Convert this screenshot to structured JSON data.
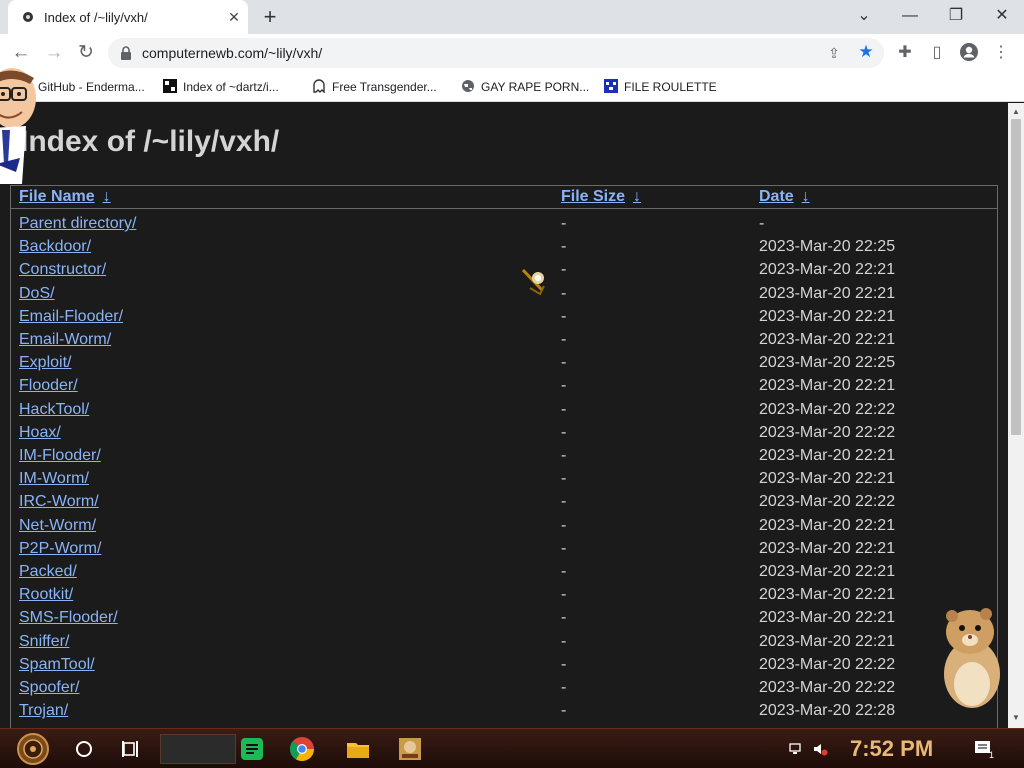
{
  "tab": {
    "title": "Index of /~lily/vxh/"
  },
  "omnibox": {
    "url": "computernewb.com/~lily/vxh/"
  },
  "bookmarks": [
    {
      "label": "GitHub - Enderma..."
    },
    {
      "label": "Index of ~dartz/i..."
    },
    {
      "label": "Free Transgender..."
    },
    {
      "label": "GAY RAPE PORN..."
    },
    {
      "label": "FILE ROULETTE"
    }
  ],
  "page": {
    "heading": "Index of /~lily/vxh/",
    "columns": {
      "name": "File Name",
      "size": "File Size",
      "date": "Date",
      "sort_arrow": "↓"
    },
    "rows": [
      {
        "name": "Parent directory/",
        "size": "-",
        "date": "-"
      },
      {
        "name": "Backdoor/",
        "size": "-",
        "date": "2023-Mar-20 22:25"
      },
      {
        "name": "Constructor/",
        "size": "-",
        "date": "2023-Mar-20 22:21"
      },
      {
        "name": "DoS/",
        "size": "-",
        "date": "2023-Mar-20 22:21"
      },
      {
        "name": "Email-Flooder/",
        "size": "-",
        "date": "2023-Mar-20 22:21"
      },
      {
        "name": "Email-Worm/",
        "size": "-",
        "date": "2023-Mar-20 22:21"
      },
      {
        "name": "Exploit/",
        "size": "-",
        "date": "2023-Mar-20 22:25"
      },
      {
        "name": "Flooder/",
        "size": "-",
        "date": "2023-Mar-20 22:21"
      },
      {
        "name": "HackTool/",
        "size": "-",
        "date": "2023-Mar-20 22:22"
      },
      {
        "name": "Hoax/",
        "size": "-",
        "date": "2023-Mar-20 22:22"
      },
      {
        "name": "IM-Flooder/",
        "size": "-",
        "date": "2023-Mar-20 22:21"
      },
      {
        "name": "IM-Worm/",
        "size": "-",
        "date": "2023-Mar-20 22:21"
      },
      {
        "name": "IRC-Worm/",
        "size": "-",
        "date": "2023-Mar-20 22:22"
      },
      {
        "name": "Net-Worm/",
        "size": "-",
        "date": "2023-Mar-20 22:21"
      },
      {
        "name": "P2P-Worm/",
        "size": "-",
        "date": "2023-Mar-20 22:21"
      },
      {
        "name": "Packed/",
        "size": "-",
        "date": "2023-Mar-20 22:21"
      },
      {
        "name": "Rootkit/",
        "size": "-",
        "date": "2023-Mar-20 22:21"
      },
      {
        "name": "SMS-Flooder/",
        "size": "-",
        "date": "2023-Mar-20 22:21"
      },
      {
        "name": "Sniffer/",
        "size": "-",
        "date": "2023-Mar-20 22:21"
      },
      {
        "name": "SpamTool/",
        "size": "-",
        "date": "2023-Mar-20 22:22"
      },
      {
        "name": "Spoofer/",
        "size": "-",
        "date": "2023-Mar-20 22:22"
      },
      {
        "name": "Trojan/",
        "size": "-",
        "date": "2023-Mar-20 22:28"
      }
    ]
  },
  "taskbar": {
    "clock": "7:52 PM",
    "notification_count": "1"
  },
  "colors": {
    "link": "#8ab4f8",
    "text": "#d4d4d4",
    "page_bg": "#1b1b1b",
    "star": "#1a73e8"
  },
  "icons": [
    "favicon-icon",
    "close-icon",
    "plus-icon",
    "minimize-icon",
    "maximize-icon",
    "back-icon",
    "forward-icon",
    "reload-icon",
    "lock-icon",
    "share-icon",
    "star-icon",
    "extensions-icon",
    "sidepanel-icon",
    "profile-icon",
    "menu-icon",
    "start-icon",
    "cortana-icon",
    "taskview-icon",
    "spotify-icon",
    "chrome-icon",
    "explorer-icon",
    "app-icon",
    "network-icon",
    "volume-icon",
    "notification-icon"
  ]
}
